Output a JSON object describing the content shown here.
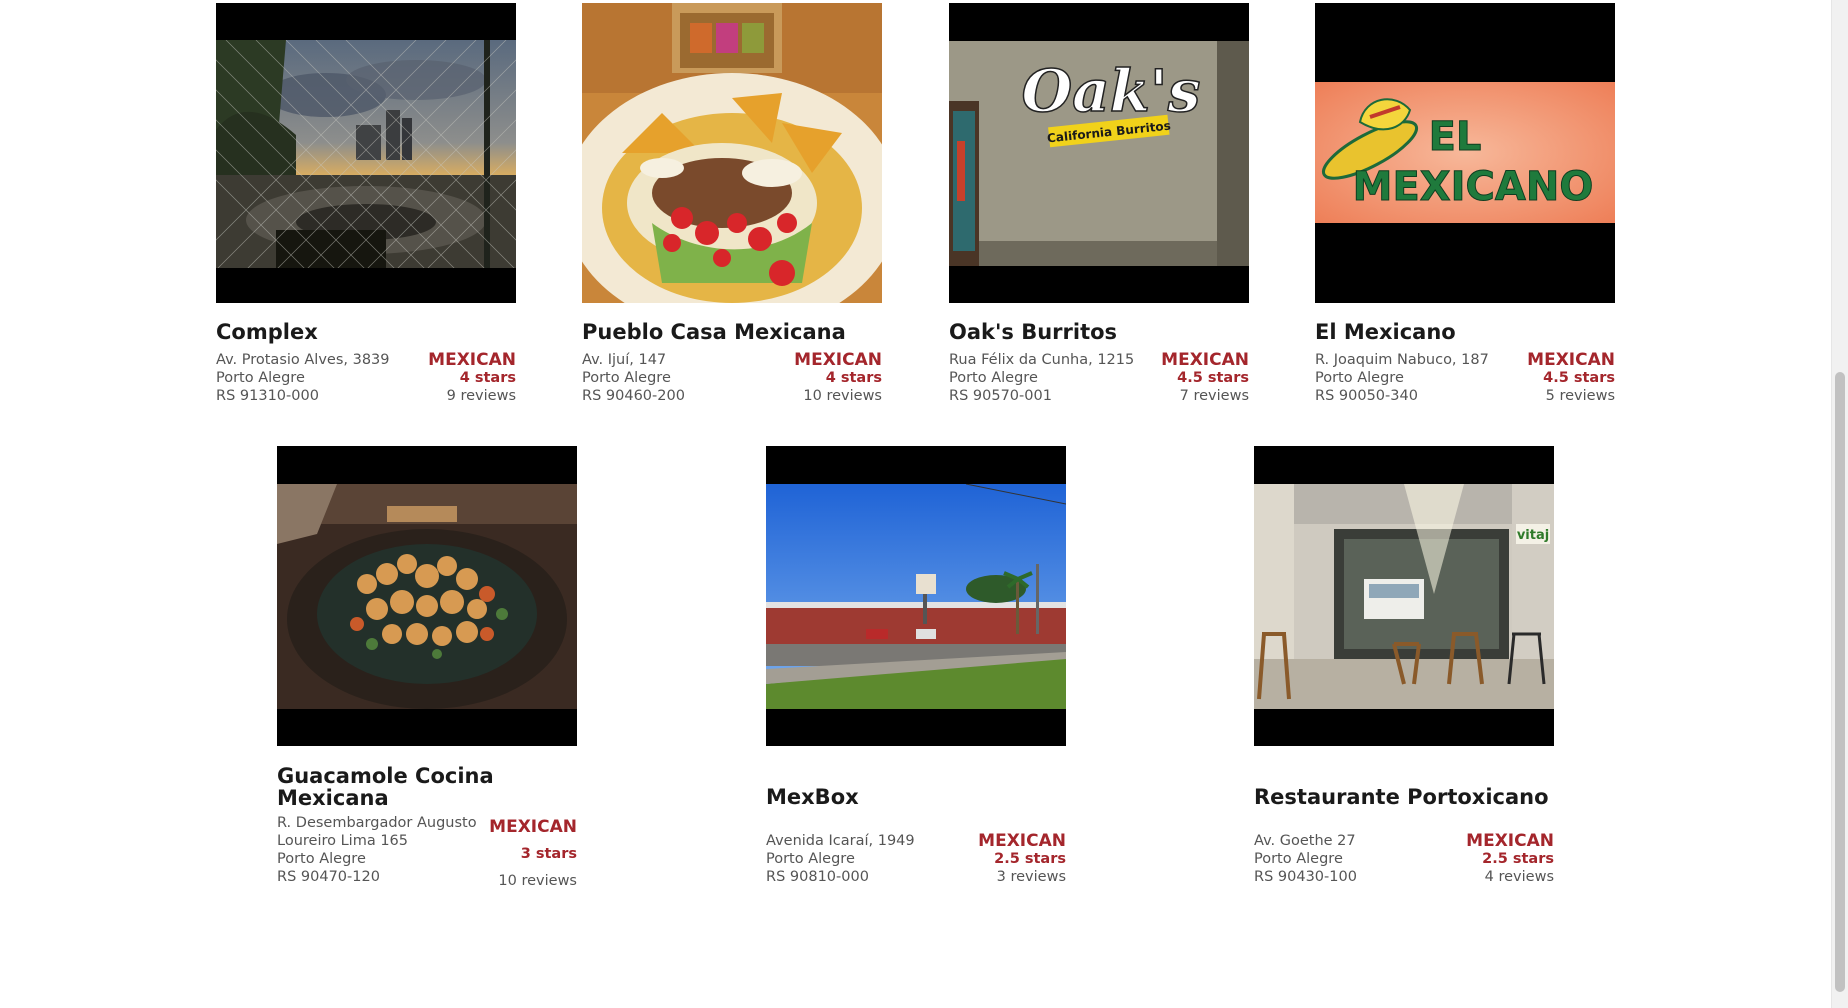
{
  "restaurants": [
    {
      "name": "Complex",
      "address": [
        "Av. Protasio Alves, 3839",
        "Porto Alegre",
        "RS 91310-000"
      ],
      "category": "MEXICAN",
      "rating": "4 stars",
      "reviews": "9 reviews",
      "image_icon": "chain-fence-sunset-photo"
    },
    {
      "name": "Pueblo Casa Mexicana",
      "address": [
        "Av. Ijuí, 147",
        "Porto Alegre",
        "RS 90460-200"
      ],
      "category": "MEXICAN",
      "rating": "4 stars",
      "reviews": "10 reviews",
      "image_icon": "taco-plate-photo"
    },
    {
      "name": "Oak's Burritos",
      "address": [
        "Rua Félix da Cunha, 1215",
        "Porto Alegre",
        "RS 90570-001"
      ],
      "category": "MEXICAN",
      "rating": "4.5 stars",
      "reviews": "7 reviews",
      "image_icon": "oaks-sign-photo",
      "sign_text": [
        "Oak's",
        "California Burritos"
      ]
    },
    {
      "name": "El Mexicano",
      "address": [
        "R. Joaquim Nabuco, 187",
        "Porto Alegre",
        "RS 90050-340"
      ],
      "category": "MEXICAN",
      "rating": "4.5 stars",
      "reviews": "5 reviews",
      "image_icon": "el-mexicano-logo-photo",
      "sign_text": [
        "EL",
        "MEXICANO"
      ]
    },
    {
      "name": "Guacamole Cocina Mexicana",
      "address": [
        "R. Desembargador Augusto",
        "Loureiro Lima 165",
        "Porto Alegre",
        "RS 90470-120"
      ],
      "category": "MEXICAN",
      "rating": "3 stars",
      "reviews": "10 reviews",
      "image_icon": "shrimp-dish-photo"
    },
    {
      "name": "MexBox",
      "address": [
        "Avenida Icaraí, 1949",
        "Porto Alegre",
        "RS 90810-000"
      ],
      "category": "MEXICAN",
      "rating": "2.5 stars",
      "reviews": "3 reviews",
      "image_icon": "street-view-photo"
    },
    {
      "name": "Restaurante Portoxicano",
      "address": [
        "Av. Goethe 27",
        "Porto Alegre",
        "RS 90430-100"
      ],
      "category": "MEXICAN",
      "rating": "2.5 stars",
      "reviews": "4 reviews",
      "image_icon": "storefront-photo",
      "sign_text": [
        "vitaj"
      ]
    }
  ],
  "colors": {
    "accent": "#a4262c",
    "text": "#1a1a1a",
    "muted": "#555555",
    "image_bg": "#000000"
  }
}
